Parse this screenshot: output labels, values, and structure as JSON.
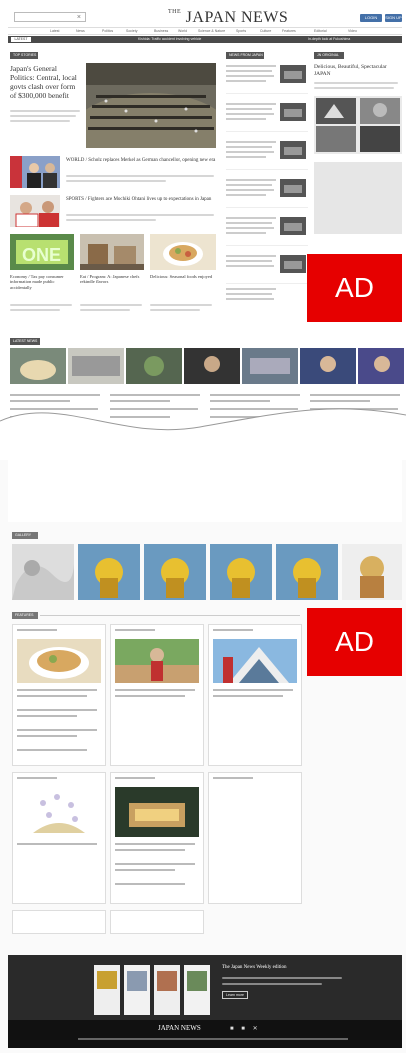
{
  "header": {
    "logo_prefix": "THE",
    "logo_main": "JAPAN NEWS",
    "login_label": "LOGIN",
    "signup_label": "SIGN UP",
    "nav": [
      "Latest",
      "News",
      "Politics",
      "Society",
      "Business",
      "World",
      "Science & Nature",
      "Sports",
      "Culture",
      "Features",
      "Editorial",
      "Video"
    ],
    "ticker_tag": "LATEST",
    "ticker_left": "Kishida: Traffic accident involving vehicle",
    "ticker_right": "In-depth look at Fukushima"
  },
  "sections": {
    "top_stories": "TOP STORIES",
    "news_from_japan": "NEWS FROM JAPAN",
    "jn_original": "JN ORIGINAL",
    "latest_news": "LATEST NEWS",
    "gallery": "GALLERY",
    "features": "FEATURES"
  },
  "top": {
    "main_title": "Japan's General Politics: Central, local govts clash over form of $300,000 benefit",
    "story2": "WORLD / Scholz replaces Merkel as German chancellor, opening new era",
    "story3": "SPORTS / Fighters ace Mochiki Ohtani lives up to expectations in Japan",
    "grid_titles": [
      "Economy / Tax pay consumer information made public accidentally",
      "Eat / Program: A: Japanese chefs rekindle flavors",
      "Delicious: Seasonal foods enjoyed"
    ]
  },
  "original": {
    "title": "Delicious, Beautiful, Spectacular JAPAN"
  },
  "ad": {
    "label1": "AD",
    "label2": "AD"
  },
  "footer": {
    "headline": "The Japan News Weekly edition",
    "more_label": "Learn more",
    "logo": "JAPAN NEWS"
  }
}
